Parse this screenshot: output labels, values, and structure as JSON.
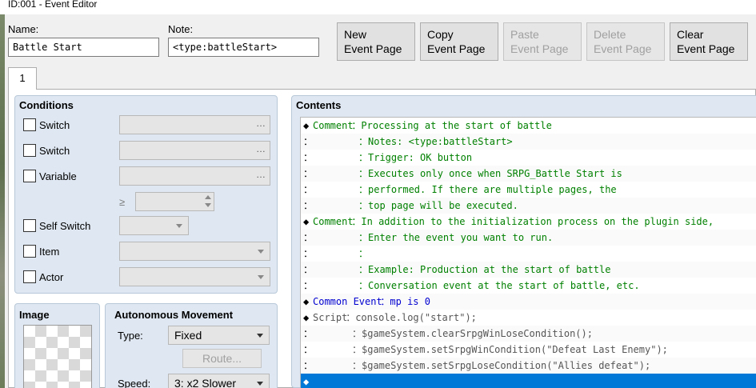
{
  "window": {
    "title": "ID:001 - Event Editor"
  },
  "name_field": {
    "label": "Name:",
    "value": "Battle Start"
  },
  "note_field": {
    "label": "Note:",
    "value": "<type:battleStart>"
  },
  "toolbar": {
    "new_page": "New\nEvent Page",
    "copy_page": "Copy\nEvent Page",
    "paste_page": "Paste\nEvent Page",
    "delete_page": "Delete\nEvent Page",
    "clear_page": "Clear\nEvent Page"
  },
  "tabs": [
    {
      "label": "1"
    }
  ],
  "conditions": {
    "title": "Conditions",
    "switch1": "Switch",
    "switch2": "Switch",
    "variable": "Variable",
    "gte": "≥",
    "self_switch": "Self Switch",
    "item": "Item",
    "actor": "Actor",
    "dots": "…"
  },
  "image": {
    "title": "Image"
  },
  "movement": {
    "title": "Autonomous Movement",
    "type_label": "Type:",
    "type_value": "Fixed",
    "route_button": "Route...",
    "speed_label": "Speed:",
    "speed_value": "3: x2 Slower"
  },
  "contents": {
    "title": "Contents",
    "lines": [
      {
        "marker": "◆",
        "cmd": "Comment",
        "sep": "：",
        "text": "Processing at the start of battle",
        "kind": "comment"
      },
      {
        "marker": "：",
        "cmd": "",
        "sep": "：",
        "text": "Notes: <type:battleStart>",
        "kind": "comment"
      },
      {
        "marker": "：",
        "cmd": "",
        "sep": "：",
        "text": "Trigger: OK button",
        "kind": "comment"
      },
      {
        "marker": "：",
        "cmd": "",
        "sep": "：",
        "text": "Executes only once when SRPG_Battle Start is",
        "kind": "comment"
      },
      {
        "marker": "：",
        "cmd": "",
        "sep": "：",
        "text": "performed. If there are multiple pages, the",
        "kind": "comment"
      },
      {
        "marker": "：",
        "cmd": "",
        "sep": "：",
        "text": "top page will be executed.",
        "kind": "comment"
      },
      {
        "marker": "◆",
        "cmd": "Comment",
        "sep": "：",
        "text": "In addition to the initialization process on the plugin side,",
        "kind": "comment"
      },
      {
        "marker": "：",
        "cmd": "",
        "sep": "：",
        "text": "Enter the event you want to run.",
        "kind": "comment"
      },
      {
        "marker": "：",
        "cmd": "",
        "sep": "：",
        "text": "",
        "kind": "comment"
      },
      {
        "marker": "：",
        "cmd": "",
        "sep": "：",
        "text": "Example: Production at the start of battle",
        "kind": "comment"
      },
      {
        "marker": "：",
        "cmd": "",
        "sep": "：",
        "text": "Conversation event at the start of battle, etc.",
        "kind": "comment"
      },
      {
        "marker": "◆",
        "cmd": "Common Event",
        "sep": "：",
        "text": "mp is 0",
        "kind": "common"
      },
      {
        "marker": "◆",
        "cmd": "Script",
        "sep": "：",
        "text": "console.log(\"start\");",
        "kind": "script"
      },
      {
        "marker": "：",
        "cmd": "",
        "sep": "：",
        "text": "$gameSystem.clearSrpgWinLoseCondition();",
        "kind": "script"
      },
      {
        "marker": "：",
        "cmd": "",
        "sep": "：",
        "text": "$gameSystem.setSrpgWinCondition(\"Defeat Last Enemy\");",
        "kind": "script"
      },
      {
        "marker": "：",
        "cmd": "",
        "sep": "：",
        "text": "$gameSystem.setSrpgLoseCondition(\"Allies defeat\");",
        "kind": "script"
      },
      {
        "marker": "◆",
        "cmd": "",
        "sep": "",
        "text": "",
        "kind": "empty"
      }
    ]
  },
  "colors": {
    "comment": "#008000",
    "common": "#0000d0",
    "script": "#555555",
    "selection": "#0078d7"
  }
}
